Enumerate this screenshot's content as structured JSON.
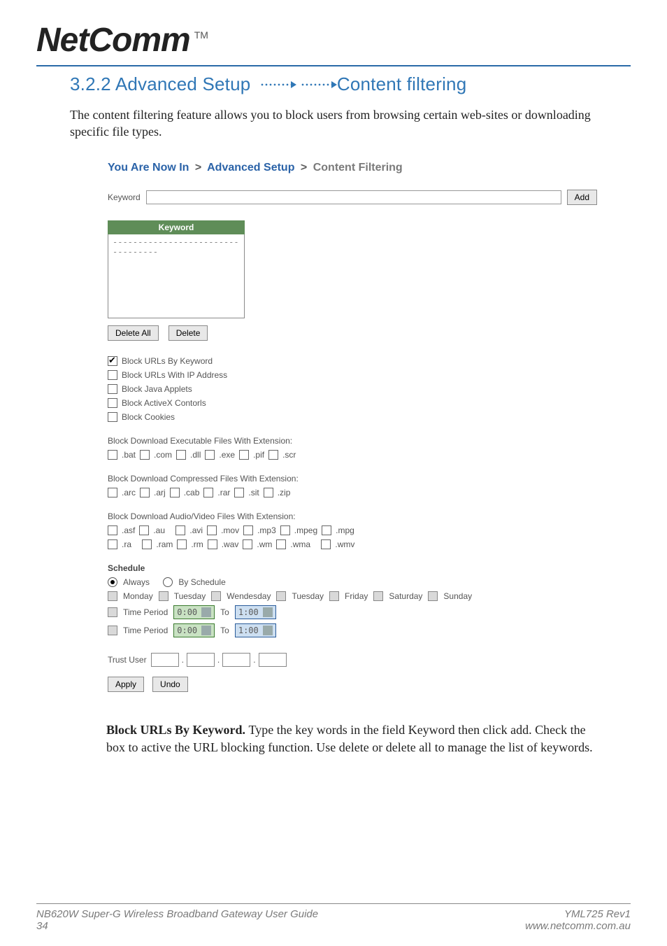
{
  "logo": {
    "brand": "NetComm",
    "tm": "TM"
  },
  "section": {
    "prefix": "3.2.2 Advanced Setup ",
    "suffix": "Content filtering"
  },
  "intro": "The content filtering feature allows you to block users from browsing certain web-sites or downloading  specific file types.",
  "breadcrumb": {
    "prefix": "You Are Now In",
    "mid": "Advanced Setup",
    "current": "Content Filtering",
    "gt": ">"
  },
  "keyword": {
    "label": "Keyword",
    "add": "Add"
  },
  "listbox": {
    "header": "Keyword",
    "placeholder": "----------------------------------"
  },
  "buttons": {
    "delete_all": "Delete All",
    "delete": "Delete",
    "apply": "Apply",
    "undo": "Undo"
  },
  "block_options": [
    {
      "label": "Block URLs By Keyword",
      "checked": true
    },
    {
      "label": "Block URLs With IP Address",
      "checked": false
    },
    {
      "label": "Block Java Applets",
      "checked": false
    },
    {
      "label": "Block ActiveX Contorls",
      "checked": false
    },
    {
      "label": "Block Cookies",
      "checked": false
    }
  ],
  "ext_exec": {
    "title": "Block Download Executable Files With Extension:",
    "items": [
      ".bat",
      ".com",
      ".dll",
      ".exe",
      ".pif",
      ".scr"
    ]
  },
  "ext_comp": {
    "title": "Block Download Compressed Files With Extension:",
    "items": [
      ".arc",
      ".arj",
      ".cab",
      ".rar",
      ".sit",
      ".zip"
    ]
  },
  "ext_av": {
    "title": "Block Download Audio/Video Files With Extension:",
    "row1": [
      ".asf",
      ".au",
      ".avi",
      ".mov",
      ".mp3",
      ".mpeg",
      ".mpg"
    ],
    "row2": [
      ".ra",
      ".ram",
      ".rm",
      ".wav",
      ".wm",
      ".wma",
      ".wmv"
    ]
  },
  "schedule": {
    "title": "Schedule",
    "always": "Always",
    "by_schedule": "By Schedule",
    "days": [
      "Monday",
      "Tuesday",
      "Wendesday",
      "Tuesday",
      "Friday",
      "Saturday",
      "Sunday"
    ],
    "time_label": "Time Period",
    "to": "To",
    "from_time": "0:00",
    "to_time": "1:00"
  },
  "trust": {
    "label": "Trust User"
  },
  "body_para": {
    "bold": "Block URLs By Keyword. ",
    "rest": "Type the key words in the field Keyword then click add. Check the box to active the URL blocking function.  Use delete or delete all to manage the list of keywords."
  },
  "footer": {
    "left_line1": "NB620W Super-G Wireless Broadband  Gateway User Guide",
    "left_line2": "34",
    "right_line1": "YML725 Rev1",
    "right_line2": "www.netcomm.com.au"
  }
}
